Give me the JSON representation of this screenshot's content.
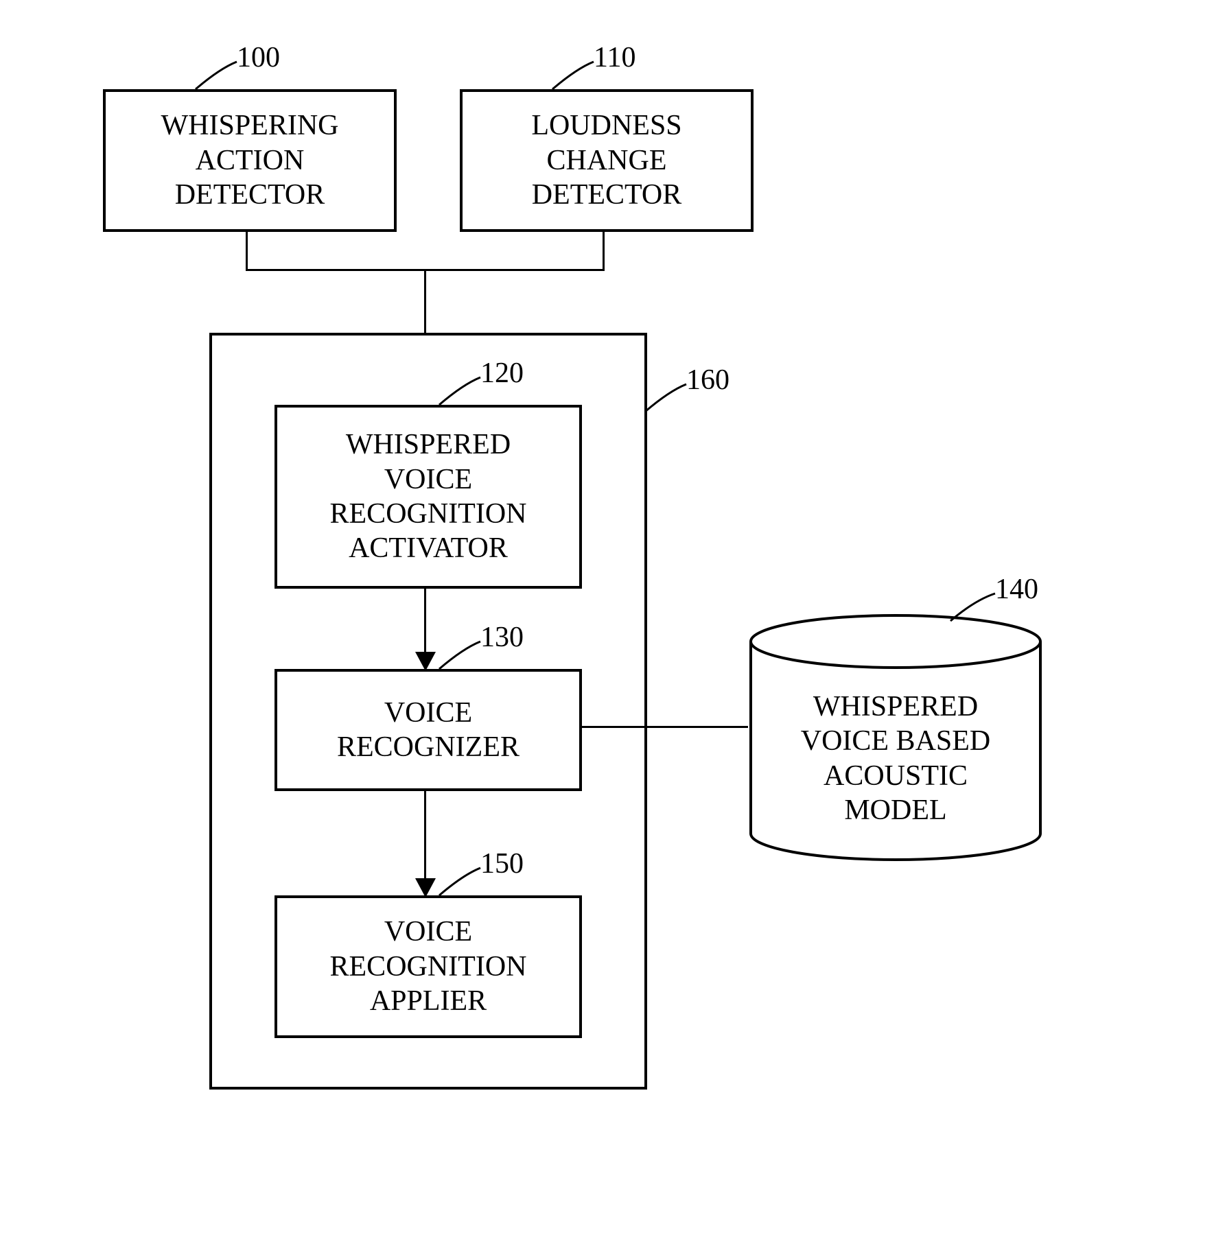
{
  "blocks": {
    "whispering_action_detector": {
      "ref": "100",
      "label": "WHISPERING\nACTION\nDETECTOR"
    },
    "loudness_change_detector": {
      "ref": "110",
      "label": "LOUDNESS\nCHANGE\nDETECTOR"
    },
    "whispered_voice_recognition_activator": {
      "ref": "120",
      "label": "WHISPERED\nVOICE\nRECOGNITION\nACTIVATOR"
    },
    "voice_recognizer": {
      "ref": "130",
      "label": "VOICE\nRECOGNIZER"
    },
    "whispered_voice_based_acoustic_model": {
      "ref": "140",
      "label": "WHISPERED\nVOICE BASED\nACOUSTIC\nMODEL"
    },
    "voice_recognition_applier": {
      "ref": "150",
      "label": "VOICE\nRECOGNITION\nAPPLIER"
    },
    "container": {
      "ref": "160"
    }
  }
}
